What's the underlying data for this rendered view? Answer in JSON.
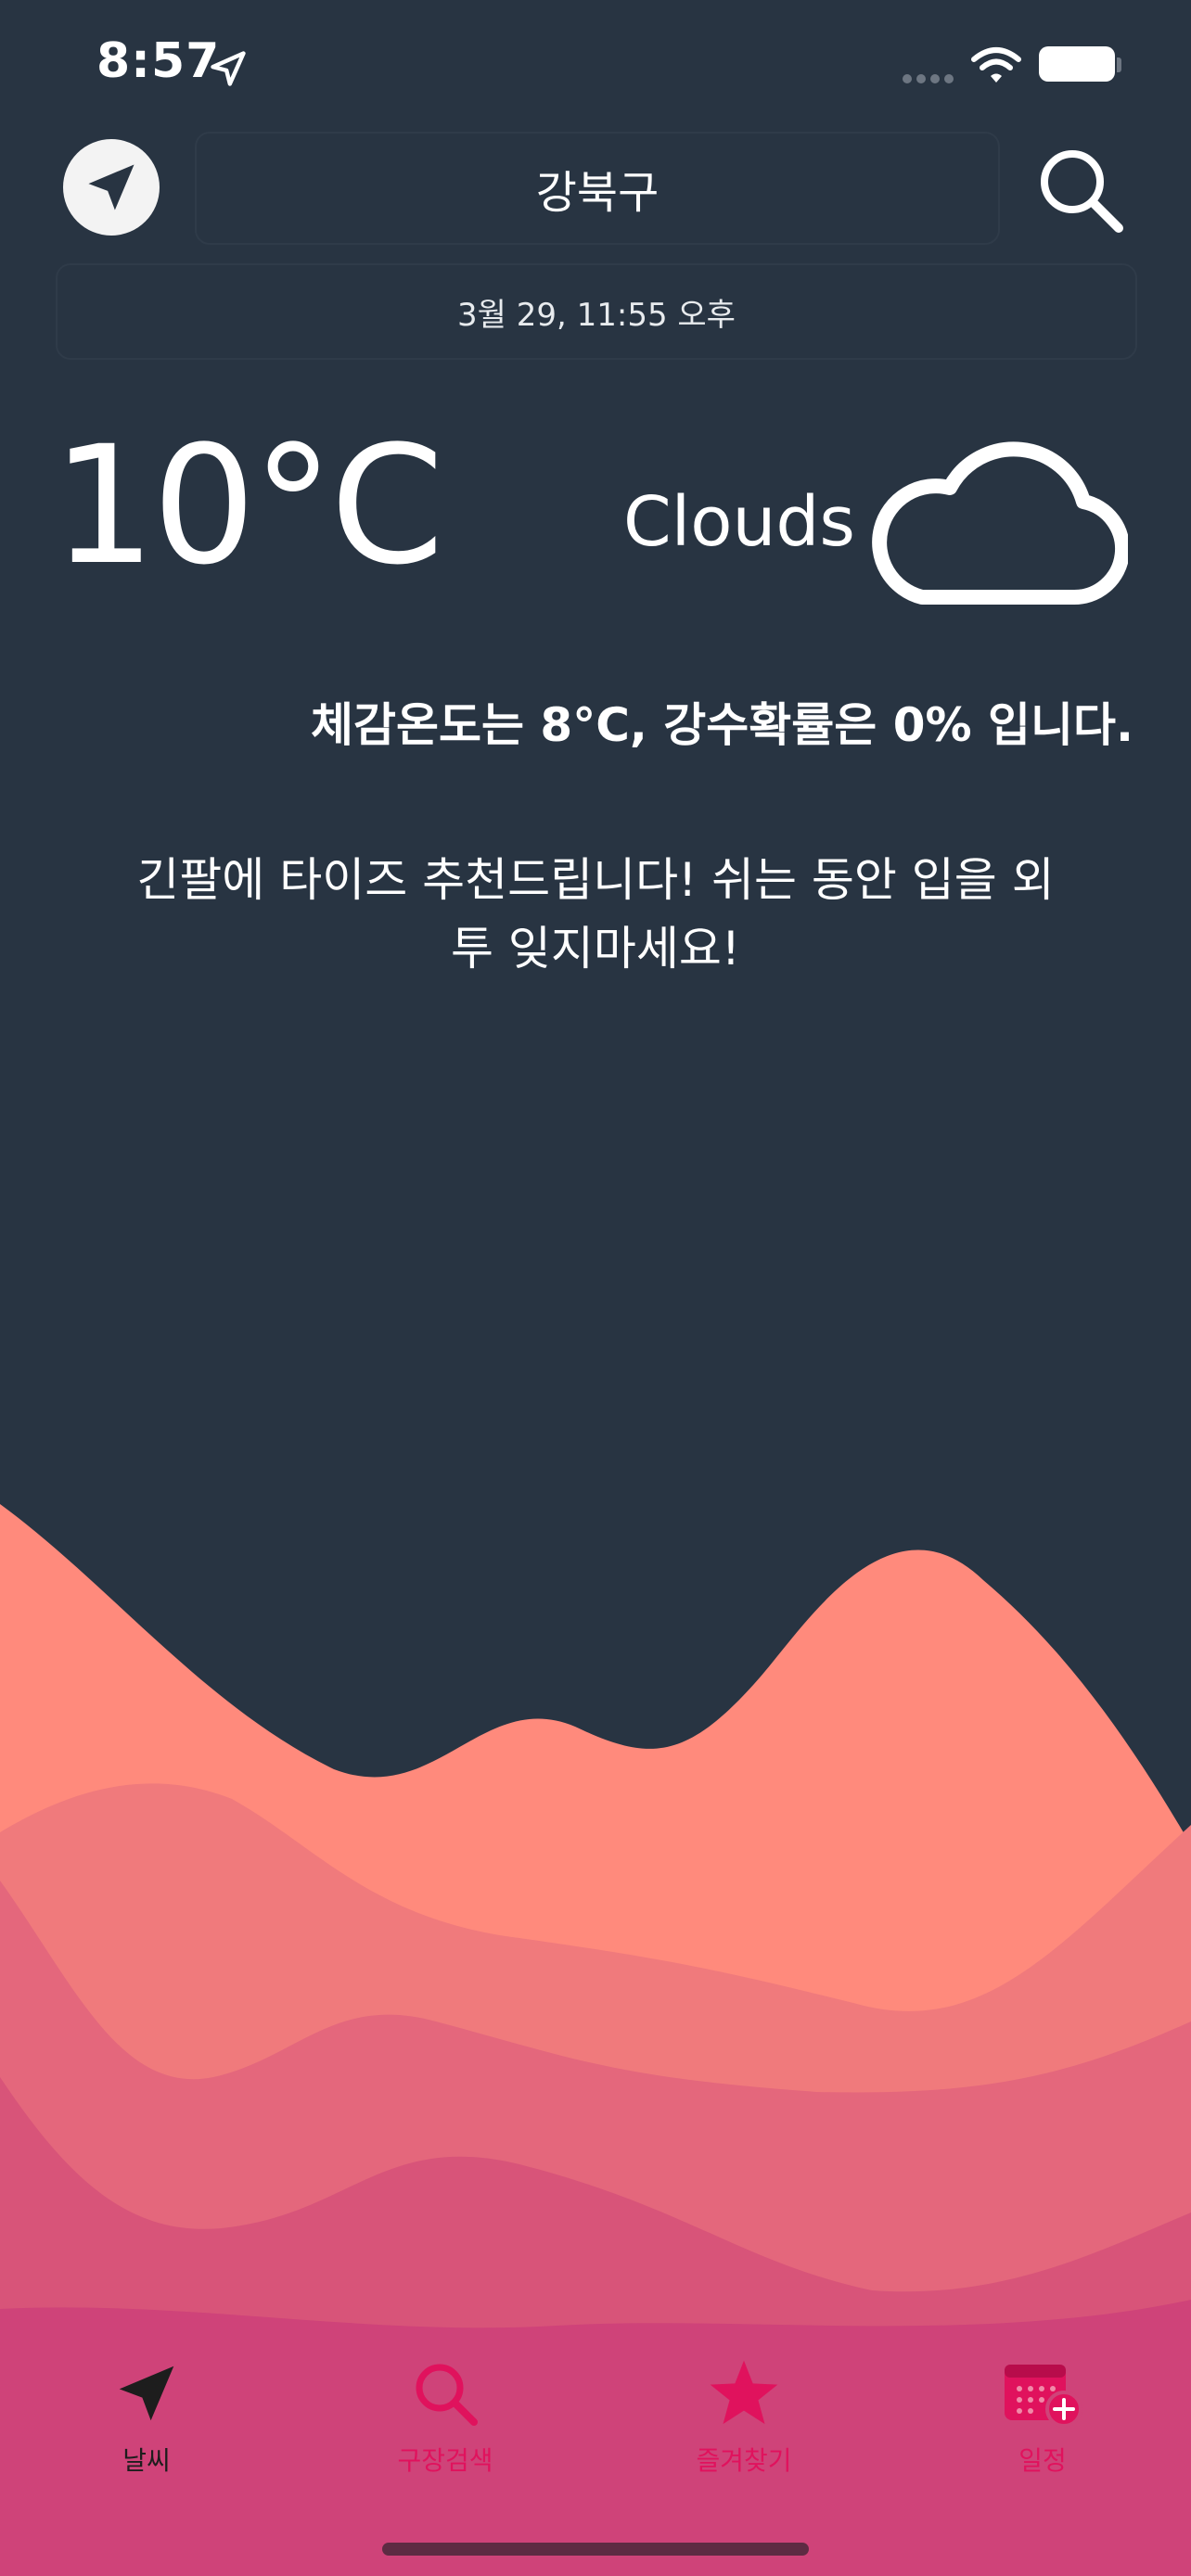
{
  "status": {
    "time": "8:57"
  },
  "header": {
    "city": "강북구",
    "datetime": "3월 29, 11:55 오후"
  },
  "weather": {
    "temperature": "10°C",
    "condition": "Clouds",
    "feels_like_text": "체감온도는 8°C, 강수확률은 0% 입니다.",
    "recommendation": "긴팔에 타이즈 추천드립니다! 쉬는 동안 입을 외투 잊지마세요!"
  },
  "tabs": [
    {
      "label": "날씨",
      "icon": "location-arrow-icon",
      "active": true
    },
    {
      "label": "구장검색",
      "icon": "search-icon",
      "active": false
    },
    {
      "label": "즐겨찾기",
      "icon": "star-icon",
      "active": false
    },
    {
      "label": "일정",
      "icon": "calendar-add-icon",
      "active": false
    }
  ],
  "colors": {
    "background": "#283442",
    "wave1": "#ff8a7c",
    "wave2": "#f07a7c",
    "wave3": "#e4677c",
    "wave4": "#d85479",
    "tabbar": "#cf4379",
    "accent": "#e0125d"
  }
}
